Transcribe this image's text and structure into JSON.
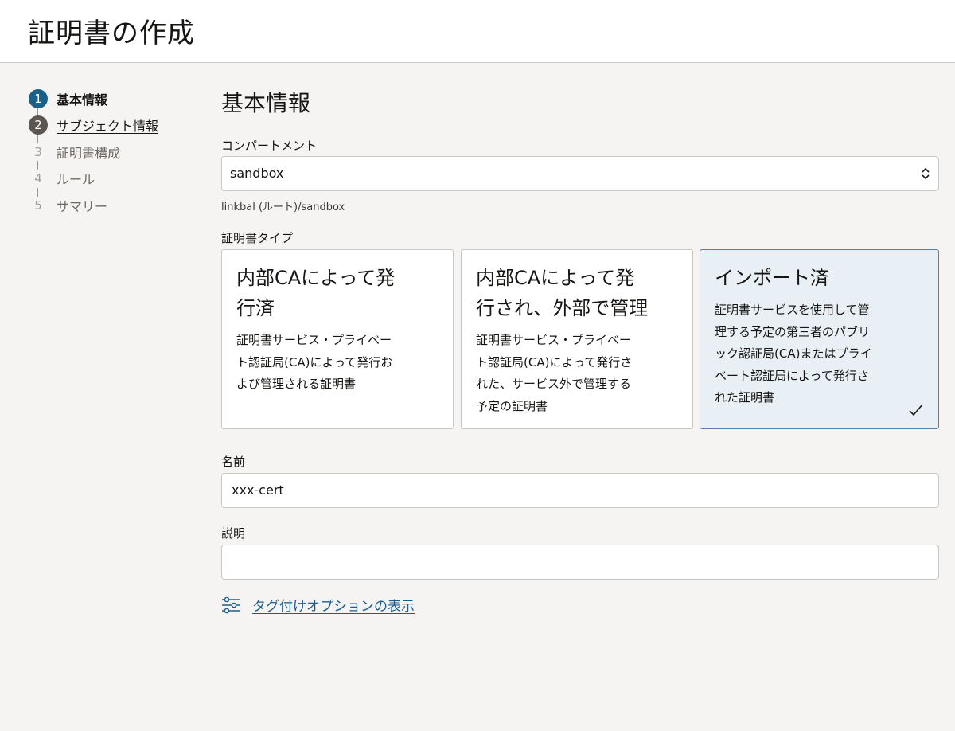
{
  "header": {
    "title": "証明書の作成"
  },
  "steps": [
    {
      "num": "1",
      "label": "基本情報",
      "state": "active"
    },
    {
      "num": "2",
      "label": "サブジェクト情報",
      "state": "visited"
    },
    {
      "num": "3",
      "label": "証明書構成",
      "state": "pending"
    },
    {
      "num": "4",
      "label": "ルール",
      "state": "pending"
    },
    {
      "num": "5",
      "label": "サマリー",
      "state": "pending"
    }
  ],
  "main": {
    "section_title": "基本情報",
    "compartment": {
      "label": "コンパートメント",
      "value": "sandbox",
      "hint": "linkbal (ルート)/sandbox"
    },
    "cert_type": {
      "label": "証明書タイプ",
      "options": [
        {
          "title": "内部CAによって発行済",
          "title_lines": [
            "内部CAによって発",
            "行済"
          ],
          "desc_lines": [
            "証明書サービス・プライベー",
            "ト認証局(CA)によって発行お",
            "よび管理される証明書"
          ],
          "selected": false
        },
        {
          "title": "内部CAによって発行され、外部で管理",
          "title_lines": [
            "内部CAによって発",
            "行され、外部で管理"
          ],
          "desc_lines": [
            "証明書サービス・プライベー",
            "ト認証局(CA)によって発行さ",
            "れた、サービス外で管理する",
            "予定の証明書"
          ],
          "selected": false
        },
        {
          "title": "インポート済",
          "title_lines": [
            "インポート済"
          ],
          "desc_lines": [
            "証明書サービスを使用して管",
            "理する予定の第三者のパブリ",
            "ック認証局(CA)またはプライ",
            "ベート認証局によって発行さ",
            "れた証明書"
          ],
          "selected": true
        }
      ]
    },
    "name": {
      "label": "名前",
      "value": "xxx-cert"
    },
    "description": {
      "label": "説明",
      "value": ""
    },
    "tag_link": "タグ付けオプションの表示"
  },
  "colors": {
    "active_step": "#1a5f85",
    "visited_step": "#5c5550",
    "link": "#1d5d8a",
    "selected_card_bg": "#e8f0f5"
  }
}
